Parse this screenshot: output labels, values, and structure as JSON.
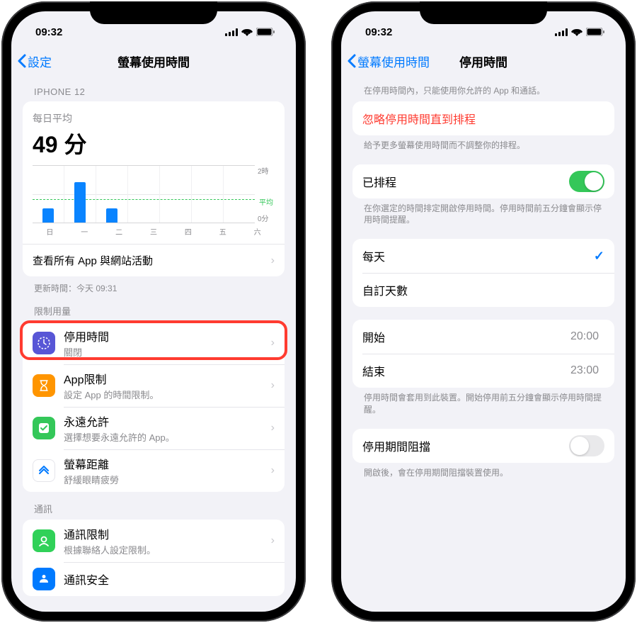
{
  "status": {
    "time": "09:32"
  },
  "left": {
    "back": "設定",
    "title": "螢幕使用時間",
    "device": "IPHONE 12",
    "avg_label": "每日平均",
    "avg_value": "49 分",
    "y_top": "2時",
    "y_avg": "平均",
    "y_bot": "0分",
    "see_all": "查看所有 App 與網站活動",
    "updated": "更新時間：今天 09:31",
    "limits_header": "限制用量",
    "items": {
      "downtime": {
        "title": "停用時間",
        "sub": "關閉"
      },
      "applimits": {
        "title": "App限制",
        "sub": "設定 App 的時間限制。"
      },
      "always": {
        "title": "永遠允許",
        "sub": "選擇想要永遠允許的 App。"
      },
      "distance": {
        "title": "螢幕距離",
        "sub": "舒緩眼睛疲勞"
      }
    },
    "comm_header": "通訊",
    "comm": {
      "title": "通訊限制",
      "sub": "根據聯絡人設定限制。"
    },
    "comm_safety": "通訊安全"
  },
  "right": {
    "back": "螢幕使用時間",
    "title": "停用時間",
    "intro": "在停用時間內，只能使用你允許的 App 和通話。",
    "ignore": "忽略停用時間直到排程",
    "ignore_footer": "給予更多螢幕使用時間而不調整你的排程。",
    "scheduled": "已排程",
    "scheduled_footer": "在你選定的時間排定開啟停用時間。停用時間前五分鐘會顯示停用時間提醒。",
    "every_day": "每天",
    "custom_days": "自訂天數",
    "start_label": "開始",
    "start_value": "20:00",
    "end_label": "結束",
    "end_value": "23:00",
    "time_footer": "停用時間會套用到此裝置。開始停用前五分鐘會顯示停用時間提醒。",
    "block": "停用期間阻擋",
    "block_footer": "開啟後，會在停用期間阻擋裝置使用。"
  },
  "chart_data": {
    "type": "bar",
    "categories": [
      "日",
      "一",
      "二",
      "三",
      "四",
      "五",
      "六"
    ],
    "values": [
      30,
      85,
      30,
      0,
      0,
      0,
      0
    ],
    "ylim": [
      0,
      120
    ],
    "avg_line": 49,
    "ylabel_top": "2時",
    "ylabel_bot": "0分"
  }
}
